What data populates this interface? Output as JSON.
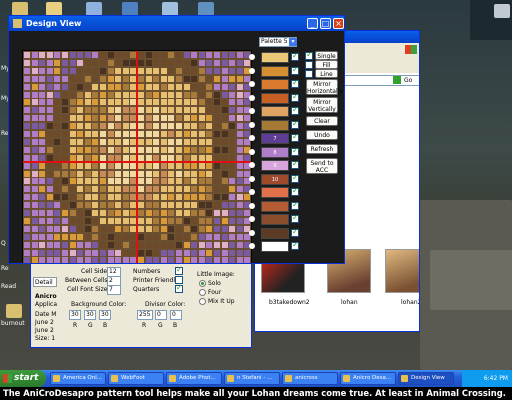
{
  "desktop": {
    "labels": [
      "My",
      "My",
      "Re",
      "Q",
      "Re",
      "Read",
      "burnout"
    ]
  },
  "design_window": {
    "title": "Design View",
    "palette_value": "Palette 5",
    "buttons": [
      "Single",
      "Fill",
      "Line",
      "Mirror Horizontally",
      "Mirror Vertically",
      "Clear",
      "Undo",
      "Refresh",
      "Send to ACC"
    ],
    "swatches": [
      {
        "label": "",
        "color": "#ecc879"
      },
      {
        "label": "",
        "color": "#d49030"
      },
      {
        "label": "",
        "color": "#d87a30"
      },
      {
        "label": "",
        "color": "#c85f24"
      },
      {
        "label": "",
        "color": "#dfa464"
      },
      {
        "label": "",
        "color": "#a67a34"
      },
      {
        "label": "7",
        "color": "#5e3e94"
      },
      {
        "label": "8",
        "color": "#b07ec8"
      },
      {
        "label": "9",
        "color": "#d8a4dc"
      },
      {
        "label": "10",
        "color": "#9e4a2a"
      },
      {
        "label": "",
        "color": "#e2704a"
      },
      {
        "label": "",
        "color": "#b45c34"
      },
      {
        "label": "",
        "color": "#8a4e2c"
      },
      {
        "label": "",
        "color": "#5c3a24"
      },
      {
        "label": "",
        "color": "#ffffff"
      }
    ]
  },
  "settings": {
    "cell_side_label": "Cell Side:",
    "cell_side": "12",
    "between_label": "Between Cells:",
    "between": "2",
    "font_label": "Cell Font Size:",
    "font": "7",
    "numbers": "Numbers",
    "printer": "Printer Friendly",
    "quarters": "Quarters",
    "little_image": "Little Image:",
    "solo": "Solo",
    "four": "Four",
    "mix": "Mix It Up",
    "bg_label": "Background Color:",
    "bg_r": "30",
    "bg_g": "30",
    "bg_b": "30",
    "div_label": "Divisor Color:",
    "div_r": "255",
    "div_g": "0",
    "div_b": "0",
    "r": "R",
    "g": "G",
    "b": "B",
    "detail_tab": "Detail",
    "partial": [
      "Anicro",
      "Applica",
      "Date M",
      "June 2",
      "June 2",
      "Size: 1"
    ]
  },
  "explorer": {
    "go": "Go",
    "thumbs": [
      "b3takedown2",
      "lohan",
      "lohan2"
    ]
  },
  "taskbar": {
    "start": "start",
    "items": [
      "America Onl...",
      "WebFoot",
      "Adobe Phot...",
      "n Stefani - ...",
      "anicross",
      "Anicro Desa...",
      "Design View"
    ],
    "clock": "6:42 PM"
  },
  "caption": "The AniCroDesapro pattern tool helps make all your Lohan dreams come true. At least in Animal Crossing."
}
